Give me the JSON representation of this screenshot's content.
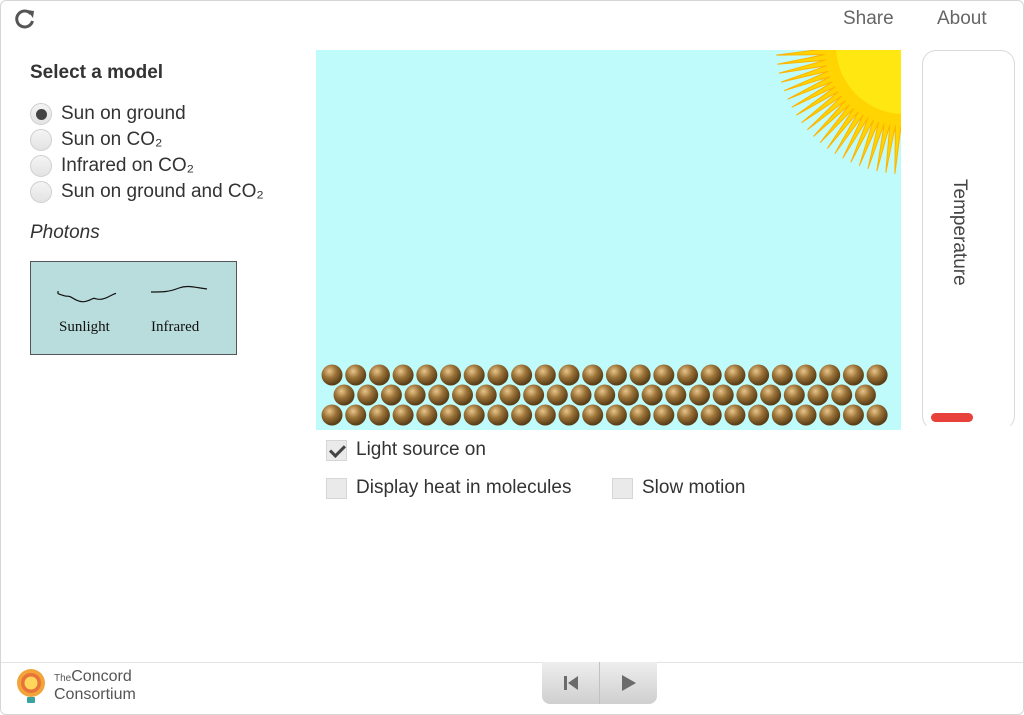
{
  "topbar": {
    "share_label": "Share",
    "about_label": "About"
  },
  "model_panel": {
    "title": "Select a model",
    "options": [
      {
        "label": "Sun on ground",
        "checked": true
      },
      {
        "label": "Sun on CO₂",
        "checked": false
      },
      {
        "label": "Infrared on CO₂",
        "checked": false
      },
      {
        "label": "Sun on ground and CO₂",
        "checked": false
      }
    ]
  },
  "photons": {
    "title": "Photons",
    "sunlight_label": "Sunlight",
    "infrared_label": "Infrared"
  },
  "simulation": {
    "sky_color": "#c0fbfb",
    "sun_color": "#ffd400",
    "particle_color": "#8a6530"
  },
  "controls": {
    "light_source_label": "Light source on",
    "light_source_checked": true,
    "heat_label": "Display heat in molecules",
    "heat_checked": false,
    "slow_motion_label": "Slow motion",
    "slow_motion_checked": false
  },
  "thermometer": {
    "label": "Temperature",
    "bar_color": "#e8403a"
  },
  "footer": {
    "logo_line1_small": "The",
    "logo_line1": "Concord",
    "logo_line2": "Consortium"
  }
}
